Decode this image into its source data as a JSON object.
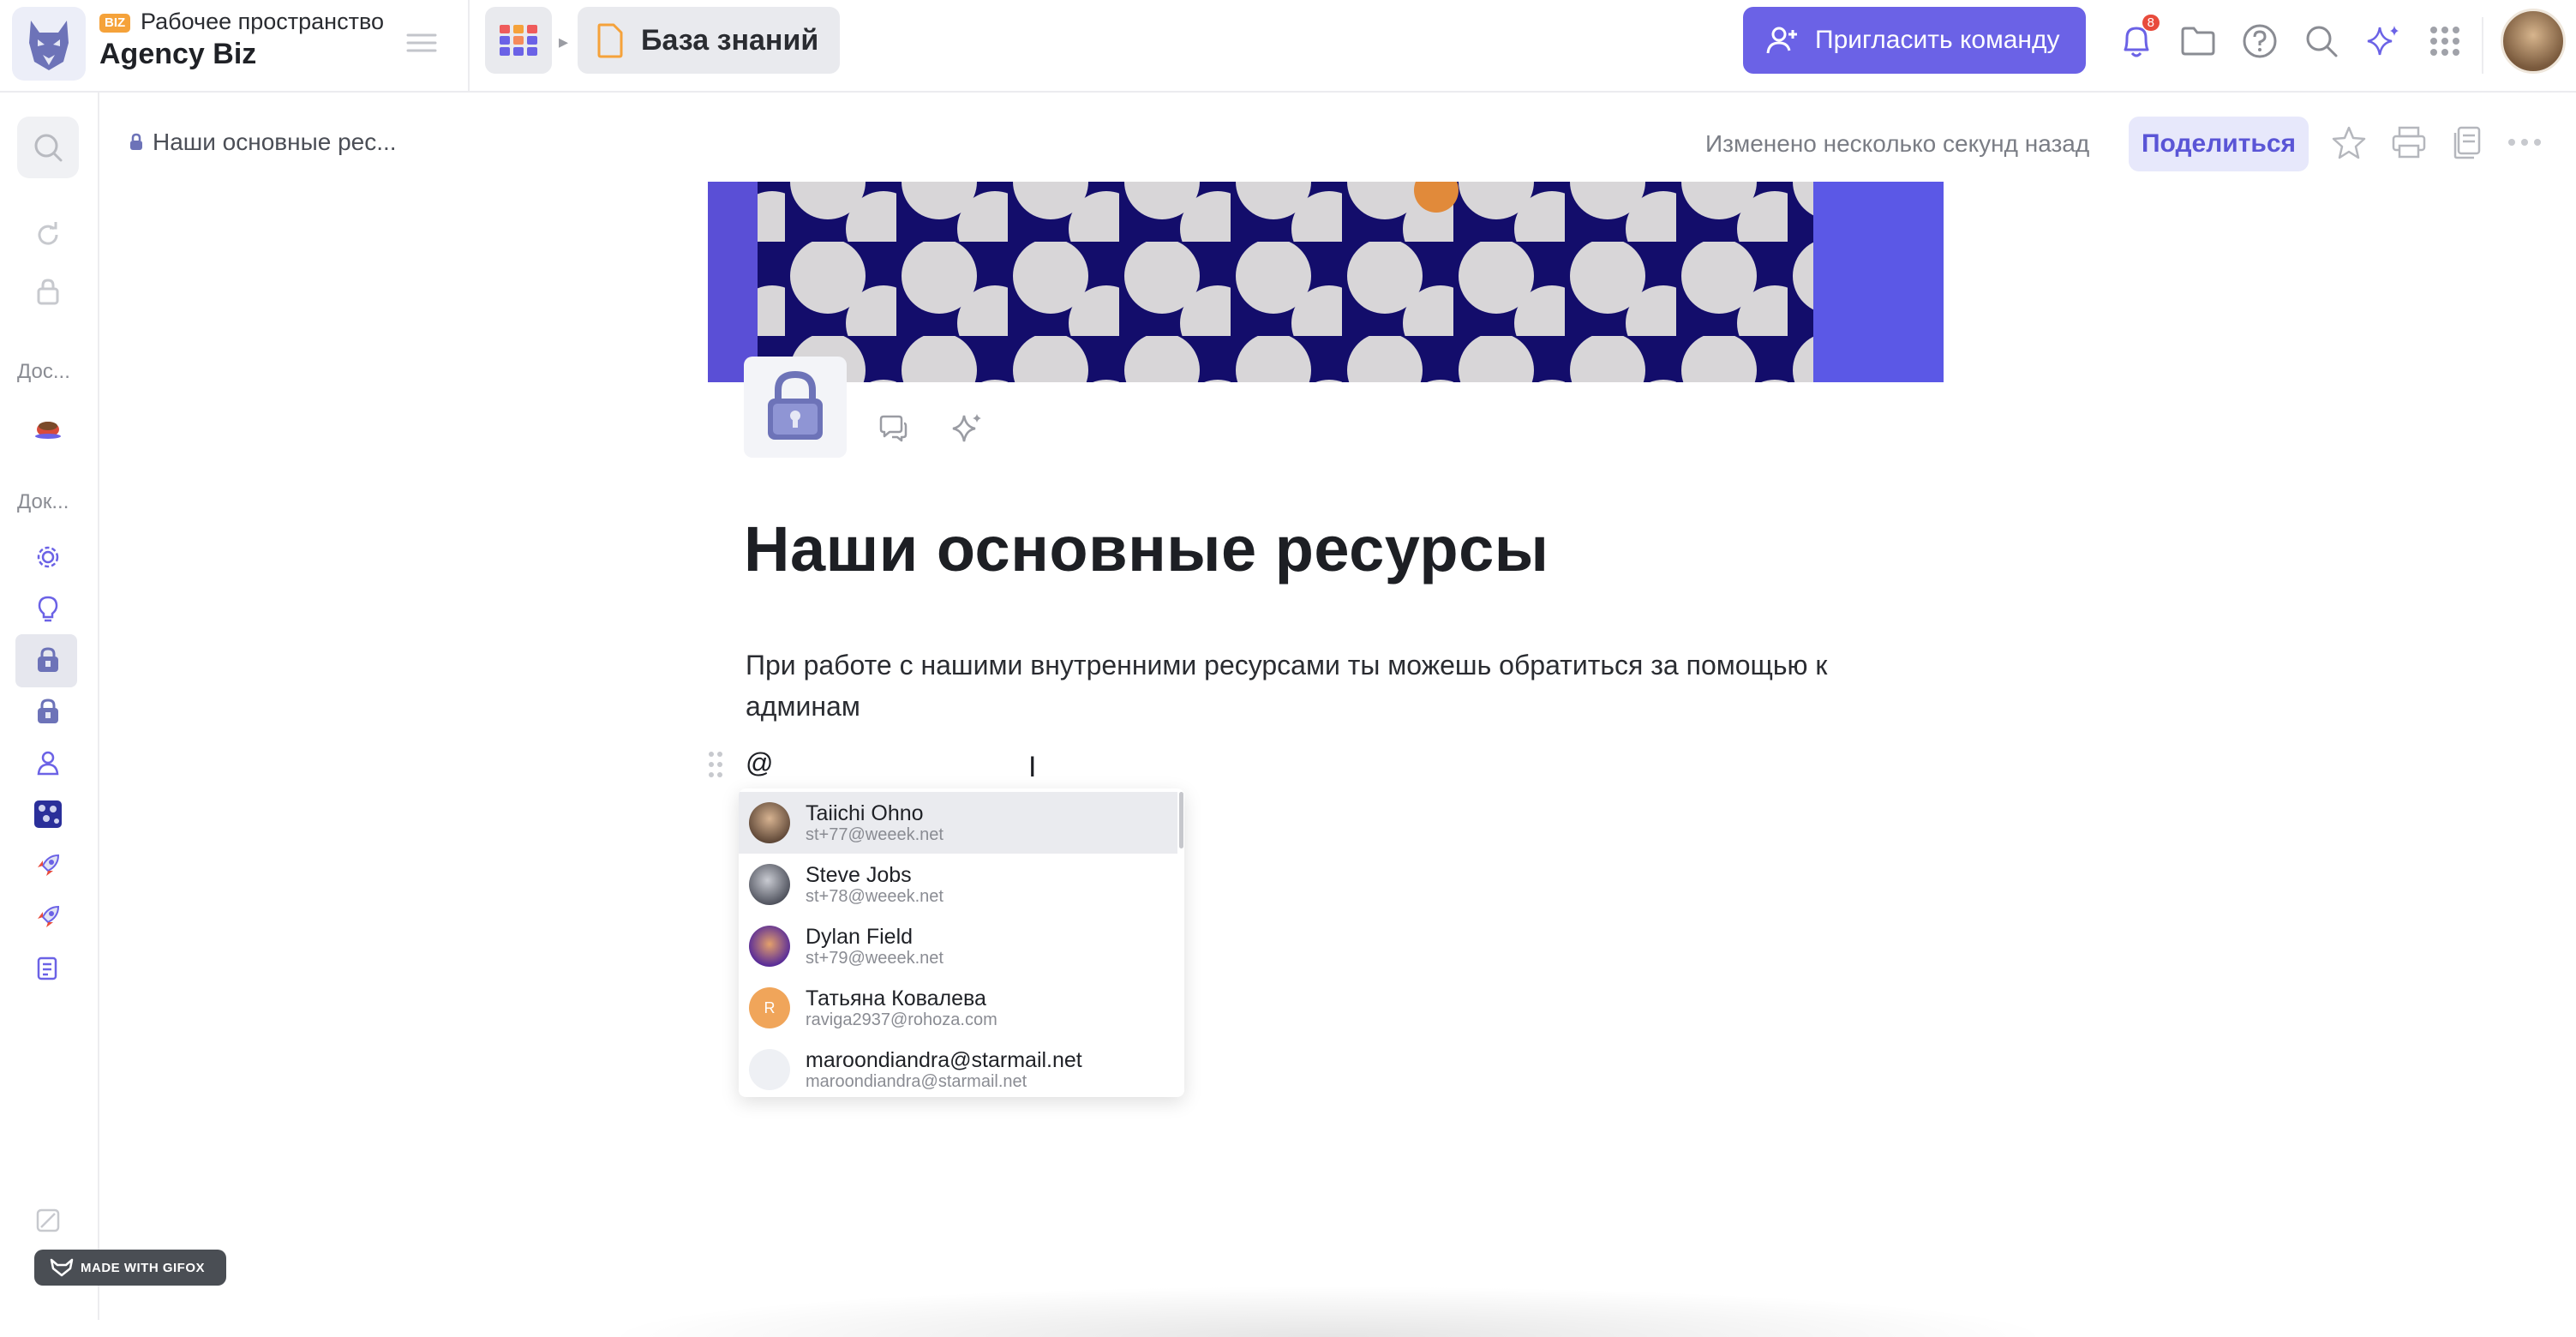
{
  "topbar": {
    "workspace_badge": "BIZ",
    "workspace_label": "Рабочее пространство",
    "workspace_name": "Agency Biz",
    "knowledge_base": "База знаний",
    "invite_label": "Пригласить команду",
    "notifications_count": "8",
    "icons": [
      "bell-icon",
      "folder-icon",
      "help-icon",
      "search-icon",
      "sparkle-icon",
      "apps-grid-icon"
    ]
  },
  "rail": {
    "section_docs_short": "Дос...",
    "section_docs2_short": "Док..."
  },
  "doc": {
    "breadcrumb": "Наши основные рес...",
    "changed": "Изменено несколько секунд назад",
    "share_label": "Поделиться",
    "title": "Наши основные ресурсы",
    "paragraph": "При работе с нашими внутренними ресурсами ты можешь обратиться за помощью к админам",
    "mention_text": "@",
    "cursor_glyph": "I"
  },
  "mentions": [
    {
      "name": "Taiichi Ohno",
      "email": "st+77@weeek.net",
      "initial": "",
      "color": "#8d6a55"
    },
    {
      "name": "Steve Jobs",
      "email": "st+78@weeek.net",
      "initial": "",
      "color": "#7d8190"
    },
    {
      "name": "Dylan Field",
      "email": "st+79@weeek.net",
      "initial": "",
      "color": "#6b3fa8"
    },
    {
      "name": "Татьяна Ковалева",
      "email": "raviga2937@rohoza.com",
      "initial": "R",
      "color": "#f0a55a"
    },
    {
      "name": "maroondiandra@starmail.net",
      "email": "maroondiandra@starmail.net",
      "initial": "",
      "color": "#eef0f4"
    }
  ],
  "gifox": "MADE WITH GIFOX",
  "colors": {
    "accent": "#6b62e6",
    "badge": "#e84b3c",
    "biz": "#f5a23a"
  }
}
